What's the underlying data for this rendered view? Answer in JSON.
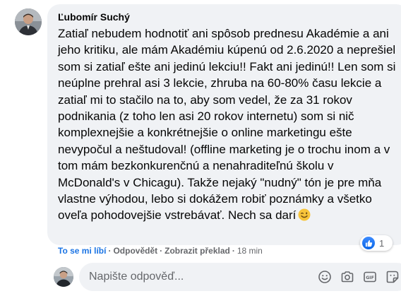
{
  "comment": {
    "author": "Ľubomír Suchý",
    "text": "Zatiaľ nebudem hodnotiť ani spôsob prednesu Akadémie a ani jeho kritiku, ale mám Akadémiu kúpenú od 2.6.2020 a neprešiel som si zatiaľ ešte ani jedinú lekciu!! Fakt ani jedinú!! Len som si neúplne prehral asi 3 lekcie, zhruba na 60-80% času lekcie a zatiaľ mi to stačilo na to, aby som vedel, že za 31 rokov podnikania (z toho len asi 20 rokov internetu) som si nič komplexnejšie a konkrétnejšie o online marketingu ešte nevypočul a neštudoval! (offline marketing je o trochu inom a v tom mám bezkonkurenčnú a nenahraditeľnú školu v McDonald's v Chicagu). Takže nejaký \"nudný\" tón je pre mňa vlastne výhodou, lebo si dokážem robiť poznámky a všetko oveľa pohodovejšie vstrebávať. Nech sa darí",
    "emoji": "winking-face-icon",
    "reaction_count": "1",
    "reaction_icon": "like-icon"
  },
  "actions": {
    "like": "To se mi líbí",
    "reply": "Odpovědět",
    "translation": "Zobrazit překlad",
    "separator": "·",
    "time": "18 min"
  },
  "reply_box": {
    "placeholder": "Napište odpověď...",
    "icons": [
      "emoji-icon",
      "camera-icon",
      "gif-icon",
      "sticker-icon"
    ]
  },
  "colors": {
    "bubble": "#f0f2f5",
    "link_blue": "#1b74e4",
    "secondary_text": "#65676b"
  }
}
